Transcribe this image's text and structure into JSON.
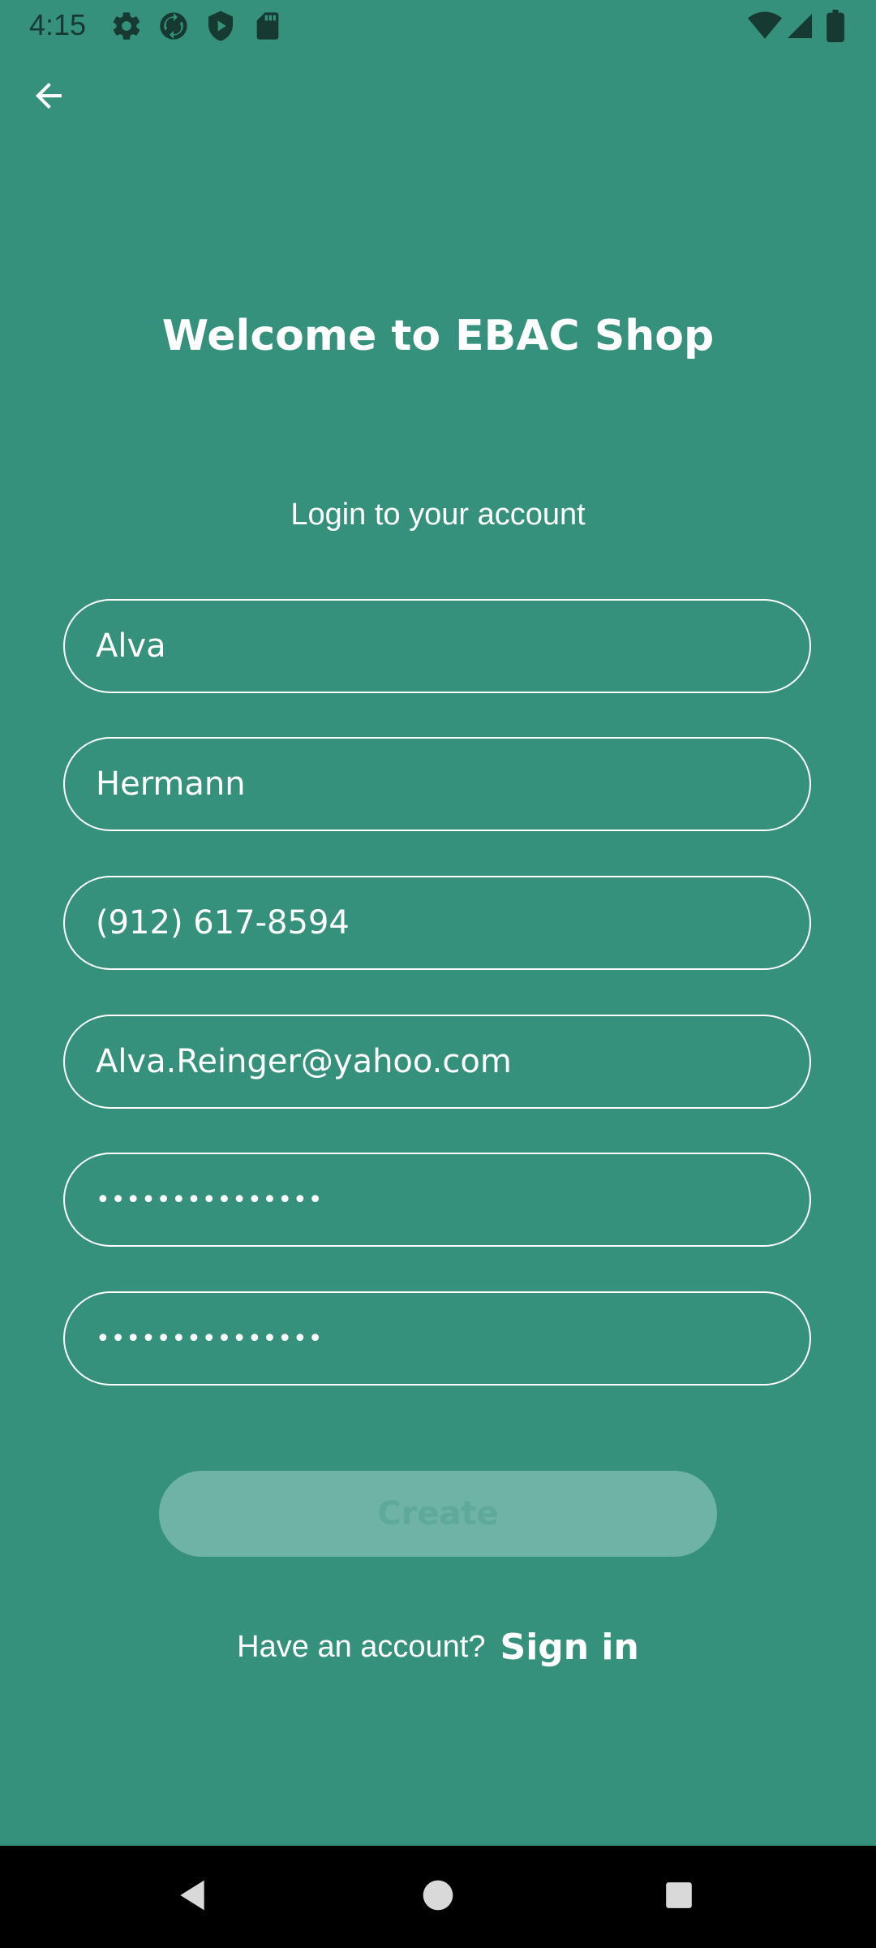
{
  "status_bar": {
    "time": "4:15",
    "left_icons": [
      "settings-icon",
      "sync-icon",
      "shield-play-icon",
      "sd-card-icon"
    ],
    "right_icons": [
      "wifi-icon",
      "signal-icon",
      "battery-icon"
    ]
  },
  "header": {
    "back_icon": "arrow-left-icon"
  },
  "main": {
    "title": "Welcome to EBAC Shop",
    "subtitle": "Login to your account",
    "fields": {
      "first_name": "Alva",
      "last_name": "Hermann",
      "phone": "(912) 617-8594",
      "email": "Alva.Reinger@yahoo.com",
      "password": "•••••••••••••••",
      "confirm_password": "•••••••••••••••"
    },
    "create_label": "Create",
    "signin_prompt": "Have an account?",
    "signin_link": "Sign in"
  },
  "nav_bar": {
    "buttons": [
      "back-triangle-icon",
      "home-circle-icon",
      "recents-square-icon"
    ]
  },
  "colors": {
    "background": "#36917C",
    "text": "#ffffff",
    "button_disabled_bg": "#6FB3A5",
    "button_disabled_text": "#5EA999",
    "status_icon": "#163a32"
  }
}
